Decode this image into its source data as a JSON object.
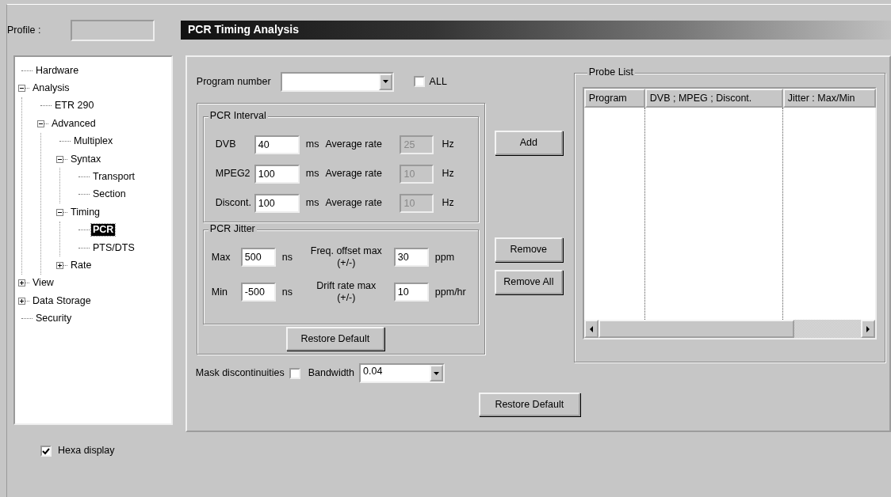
{
  "profile": {
    "label": "Profile :"
  },
  "title": "PCR Timing Analysis",
  "tree": [
    {
      "label": "Hardware",
      "selected": false
    },
    {
      "label": "Analysis",
      "selected": false,
      "expanded": true,
      "children": [
        {
          "label": "ETR 290",
          "selected": false
        },
        {
          "label": "Advanced",
          "selected": false,
          "expanded": true,
          "children": [
            {
              "label": "Multiplex",
              "selected": false
            },
            {
              "label": "Syntax",
              "selected": false,
              "expanded": true,
              "children": [
                {
                  "label": "Transport",
                  "selected": false
                },
                {
                  "label": "Section",
                  "selected": false
                }
              ]
            },
            {
              "label": "Timing",
              "selected": false,
              "expanded": true,
              "children": [
                {
                  "label": "PCR",
                  "selected": true
                },
                {
                  "label": "PTS/DTS",
                  "selected": false
                }
              ]
            },
            {
              "label": "Rate",
              "selected": false,
              "expanded": false
            }
          ]
        }
      ]
    },
    {
      "label": "View",
      "selected": false,
      "expanded": false
    },
    {
      "label": "Data Storage",
      "selected": false,
      "expanded": false
    },
    {
      "label": "Security",
      "selected": false
    }
  ],
  "program": {
    "label": "Program number",
    "all_label": "ALL",
    "all_checked": false
  },
  "interval": {
    "title": "PCR Interval",
    "rows": [
      {
        "label": "DVB",
        "value": "40",
        "unit": "ms",
        "rate_label": "Average rate",
        "rate_value": "25",
        "rate_disabled": true,
        "rate_unit": "Hz"
      },
      {
        "label": "MPEG2",
        "value": "100",
        "unit": "ms",
        "rate_label": "Average rate",
        "rate_value": "10",
        "rate_disabled": true,
        "rate_unit": "Hz"
      },
      {
        "label": "Discont.",
        "value": "100",
        "unit": "ms",
        "rate_label": "Average rate",
        "rate_value": "10",
        "rate_disabled": true,
        "rate_unit": "Hz"
      }
    ]
  },
  "jitter": {
    "title": "PCR Jitter",
    "rows": [
      {
        "label": "Max",
        "value": "500",
        "unit": "ns",
        "param_label": "Freq. offset max",
        "param_sub": "(+/-)",
        "param_value": "30",
        "param_unit": "ppm"
      },
      {
        "label": "Min",
        "value": "-500",
        "unit": "ns",
        "param_label": "Drift rate max",
        "param_sub": "(+/-)",
        "param_value": "10",
        "param_unit": "ppm/hr"
      }
    ]
  },
  "inner_restore": "Restore Default",
  "buttons": [
    "Add",
    "Remove",
    "Remove All"
  ],
  "probe_list": {
    "title": "Probe List",
    "columns": [
      "Program",
      "DVB ; MPEG ; Discont.",
      "Jitter : Max/Min"
    ]
  },
  "mask": {
    "label": "Mask discontinuities",
    "checked": false,
    "bandwidth_label": "Bandwidth",
    "bandwidth_value": "0.04"
  },
  "restore_default": "Restore Default",
  "hexa": {
    "label": "Hexa display",
    "checked": true
  }
}
